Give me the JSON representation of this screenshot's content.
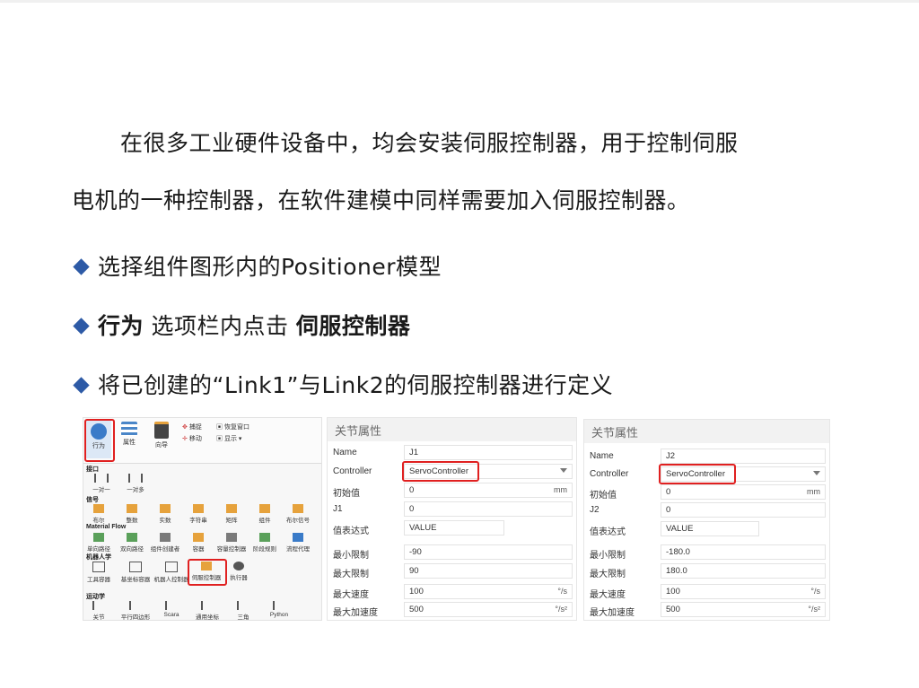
{
  "slide": {
    "paragraph_line1": "在很多工业硬件设备中，均会安装伺服控制器，用于控制伺服",
    "paragraph_line2": "电机的一种控制器，在软件建模中同样需要加入伺服控制器。",
    "bullet1": "选择组件图形内的Positioner模型",
    "bullet2_bold1": "行为",
    "bullet2_mid": " 选项栏内点击 ",
    "bullet2_bold2": "伺服控制器",
    "bullet3": "将已创建的“Link1”与Link2的伺服控制器进行定义"
  },
  "ribbon": {
    "behavior": "行为",
    "properties": "属性",
    "wizard": "向导",
    "capture": "捕捉",
    "move": "移动",
    "display_window": "恢复窗口",
    "display": "显示",
    "sections": {
      "interface": "接口",
      "signal": "信号",
      "material_flow": "Material Flow",
      "robotics": "机器人学",
      "kinematics": "运动学"
    },
    "interface_items": [
      "一对一",
      "一对多"
    ],
    "signal_items": [
      "布尔",
      "整数",
      "实数",
      "字符串",
      "矩阵",
      "组件",
      "布尔信号"
    ],
    "flow_items": [
      "单向路径",
      "双向路径",
      "组件创建者",
      "容器",
      "容量控制器",
      "阶段规则",
      "流程代理"
    ],
    "robot_items": [
      "工具容器",
      "基坐标容器",
      "机器人控制器",
      "伺服控制器",
      "执行器"
    ],
    "kinematics_items": [
      "关节",
      "平行四边形",
      "Scara",
      "通用坐标",
      "三角",
      "Python"
    ]
  },
  "panel_left": {
    "title": "关节属性",
    "rows": [
      {
        "label": "Name",
        "value": "J1",
        "unit": ""
      },
      {
        "label": "Controller",
        "value": "ServoController",
        "unit": ""
      },
      {
        "label": "初始值",
        "value": "0",
        "unit": "mm"
      },
      {
        "label": "J1",
        "value": "0",
        "unit": ""
      },
      {
        "label": "值表达式",
        "value": "VALUE",
        "unit": ""
      },
      {
        "label": "最小限制",
        "value": "-90",
        "unit": ""
      },
      {
        "label": "最大限制",
        "value": "90",
        "unit": ""
      },
      {
        "label": "最大速度",
        "value": "100",
        "unit": "°/s"
      },
      {
        "label": "最大加速度",
        "value": "500",
        "unit": "°/s²"
      }
    ]
  },
  "panel_right": {
    "title": "关节属性",
    "rows": [
      {
        "label": "Name",
        "value": "J2",
        "unit": ""
      },
      {
        "label": "Controller",
        "value": "ServoController",
        "unit": ""
      },
      {
        "label": "初始值",
        "value": "0",
        "unit": "mm"
      },
      {
        "label": "J2",
        "value": "0",
        "unit": ""
      },
      {
        "label": "值表达式",
        "value": "VALUE",
        "unit": ""
      },
      {
        "label": "最小限制",
        "value": "-180.0",
        "unit": ""
      },
      {
        "label": "最大限制",
        "value": "180.0",
        "unit": ""
      },
      {
        "label": "最大速度",
        "value": "100",
        "unit": "°/s"
      },
      {
        "label": "最大加速度",
        "value": "500",
        "unit": "°/s²"
      }
    ]
  },
  "colors": {
    "bullet": "#2d5aa6",
    "highlight": "#e02020"
  }
}
